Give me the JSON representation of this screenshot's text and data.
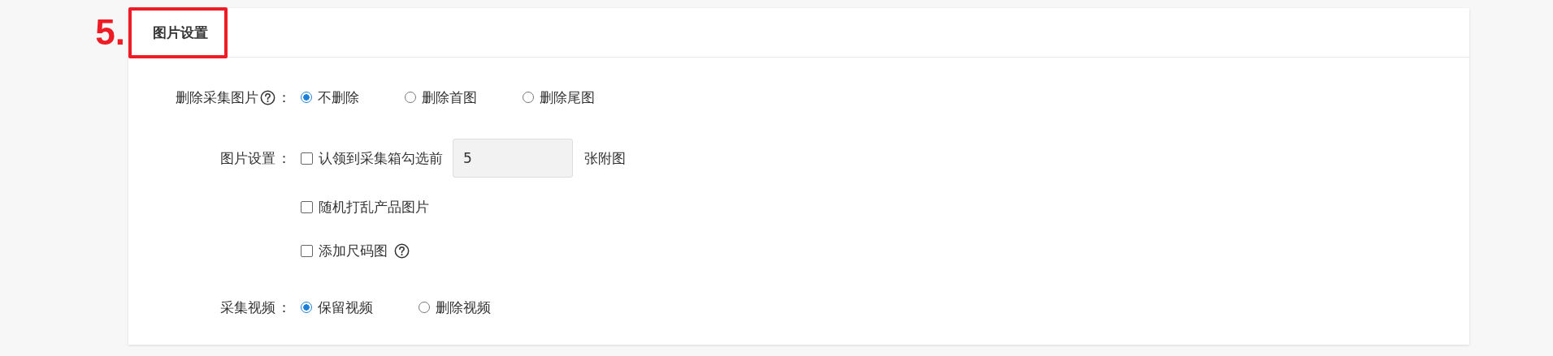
{
  "step_marker": "5.",
  "section": {
    "title": "图片设置",
    "highlighted": true
  },
  "fields": [
    {
      "kind": "radio",
      "label": "删除采集图片",
      "help": true,
      "colon": "：",
      "options": [
        {
          "label": "不删除",
          "selected": true
        },
        {
          "label": "删除首图",
          "selected": false
        },
        {
          "label": "删除尾图",
          "selected": false
        }
      ]
    },
    {
      "kind": "checks",
      "label": "图片设置",
      "colon": "：",
      "items": [
        {
          "kind": "input",
          "text": "认领到采集箱勾选前",
          "value": "5",
          "after": "张附图",
          "checked": false
        },
        {
          "kind": "plain",
          "text": "随机打乱产品图片",
          "checked": false
        },
        {
          "kind": "plain",
          "text": "添加尺码图",
          "checked": false,
          "help": true
        }
      ]
    },
    {
      "kind": "radio",
      "label": "采集视频",
      "colon": "：",
      "options": [
        {
          "label": "保留视频",
          "selected": true
        },
        {
          "label": "删除视频",
          "selected": false
        }
      ]
    }
  ]
}
